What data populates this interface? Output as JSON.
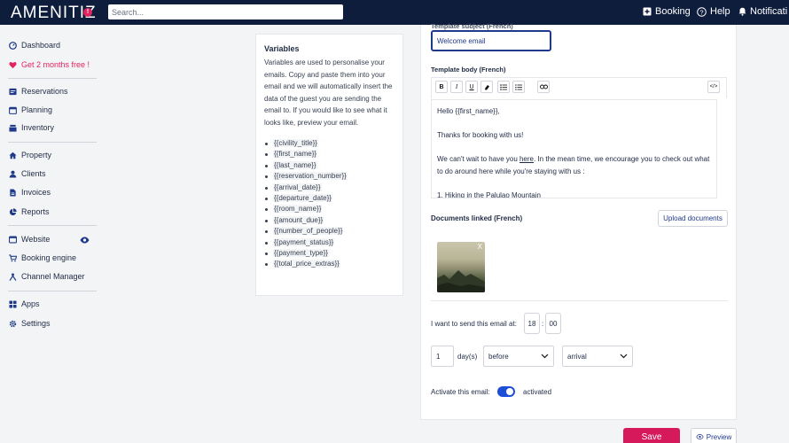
{
  "header": {
    "logo": "AMENITIZ",
    "alert_badge": "!",
    "search_placeholder": "Search...",
    "booking_label": "Booking",
    "help_label": "Help",
    "notifications_label": "Notificati"
  },
  "sidebar": {
    "items": [
      {
        "label": "Dashboard",
        "icon": "dashboard-icon"
      },
      {
        "label": "Get 2 months free !",
        "icon": "heart-icon"
      },
      {
        "label": "Reservations",
        "icon": "reservations-icon"
      },
      {
        "label": "Planning",
        "icon": "calendar-icon"
      },
      {
        "label": "Inventory",
        "icon": "inventory-icon"
      },
      {
        "label": "Property",
        "icon": "home-icon"
      },
      {
        "label": "Clients",
        "icon": "user-icon"
      },
      {
        "label": "Invoices",
        "icon": "file-icon"
      },
      {
        "label": "Reports",
        "icon": "pie-chart-icon"
      },
      {
        "label": "Website",
        "icon": "browser-icon"
      },
      {
        "label": "Booking engine",
        "icon": "cart-icon"
      },
      {
        "label": "Channel Manager",
        "icon": "channel-icon"
      },
      {
        "label": "Apps",
        "icon": "apps-icon"
      },
      {
        "label": "Settings",
        "icon": "gear-icon"
      }
    ]
  },
  "variables": {
    "title": "Variables",
    "description": "Variables are used to personalise your emails. Copy and paste them into your email and we will automatically insert the data of the guest you are sending the email to. If you would like to see what it looks like, preview your email.",
    "items": [
      "{{civility_title}}",
      "{{first_name}}",
      "{{last_name}}",
      "{{reservation_number}}",
      "{{arrival_date}}",
      "{{departure_date}}",
      "{{room_name}}",
      "{{amount_due}}",
      "{{number_of_people}}",
      "{{payment_status}}",
      "{{payment_type}}",
      "{{total_price_extras}}"
    ]
  },
  "form": {
    "subject_label": "Template subject (French)",
    "subject_value": "Welcome email",
    "body_label": "Template body (French)",
    "toolbar": {
      "bold": "B",
      "italic": "I",
      "underline": "U",
      "clear": "⌫",
      "bullets": "☰",
      "numbers": "☷",
      "link": "🔗",
      "code": "</>"
    },
    "body": {
      "line1": "Hello {{first_name}},",
      "line2": "Thanks for booking with us!",
      "line3_pre": "We can't wait to have you ",
      "line3_link": "here",
      "line3_post": ". In the mean time, we encourage you to check out what to do around here while you're staying with us :",
      "line4_pre": "1. Hiking in the ",
      "line4_word": "Palulao",
      "line4_post": " Mountain"
    },
    "documents_label": "Documents linked (French)",
    "upload_label": "Upload documents",
    "doc_remove": "X",
    "send_label": "I want to send this email at:",
    "hour": "18",
    "time_sep": ":",
    "minute": "00",
    "days_value": "1",
    "days_unit": "day(s)",
    "relation": "before",
    "event": "arrival",
    "activate_label": "Activate this email:",
    "activate_state": "activated"
  },
  "actions": {
    "save_label": "Save",
    "preview_label": "Preview"
  },
  "colors": {
    "navy": "#0f1d3d",
    "accent": "#d6195b",
    "toggle": "#1d4ed8"
  }
}
